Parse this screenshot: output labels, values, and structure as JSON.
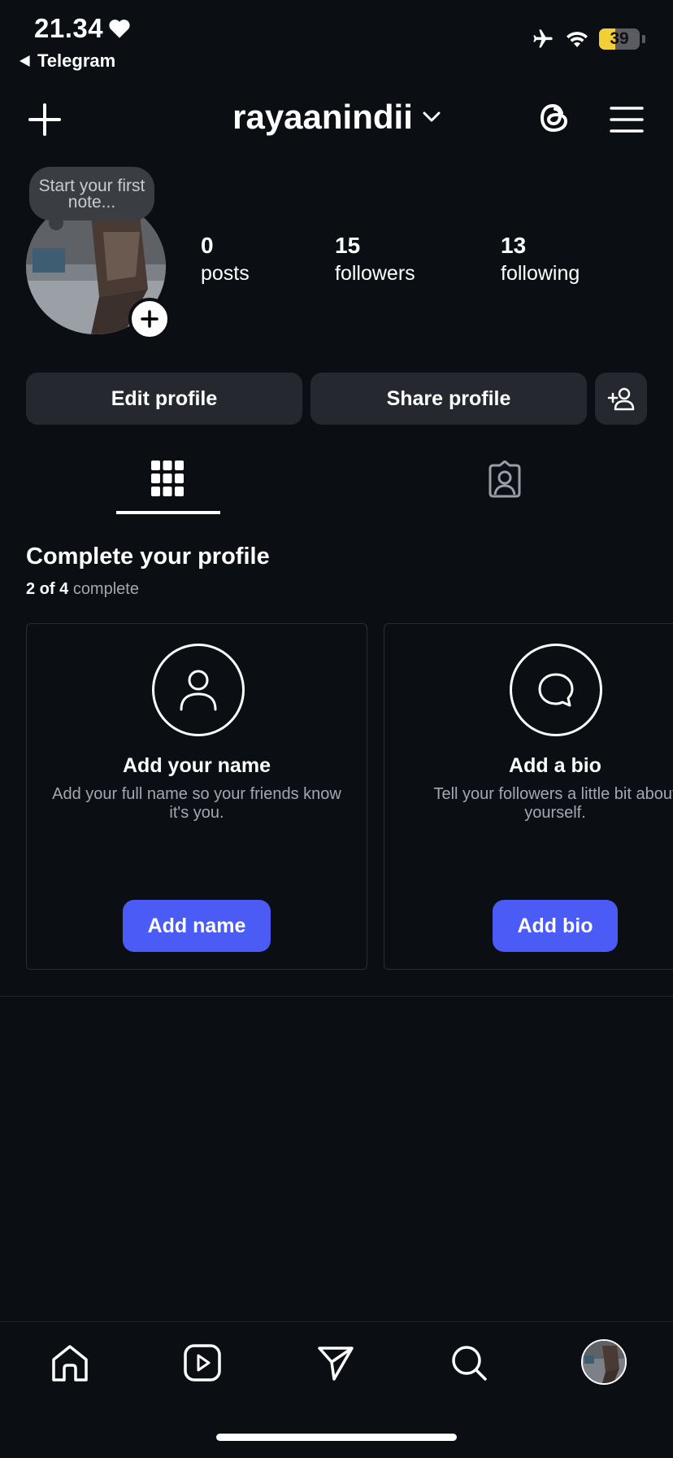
{
  "status_bar": {
    "time": "21.34",
    "back_app": "Telegram",
    "battery_level": "39",
    "battery_fraction": 0.39,
    "icons": [
      "heart-icon",
      "airplane-icon",
      "wifi-icon",
      "battery-icon"
    ]
  },
  "header": {
    "username": "rayaanindii",
    "icons": [
      "plus-icon",
      "chevron-down-icon",
      "threads-icon",
      "menu-icon"
    ]
  },
  "profile": {
    "note_placeholder": "Start your first note...",
    "stats": [
      {
        "value": "0",
        "label": "posts"
      },
      {
        "value": "15",
        "label": "followers"
      },
      {
        "value": "13",
        "label": "following"
      }
    ]
  },
  "actions": {
    "edit_profile": "Edit profile",
    "share_profile": "Share profile",
    "discover_icon": "add-person-icon"
  },
  "tabs": [
    {
      "name": "grid",
      "icon": "grid-icon",
      "active": true
    },
    {
      "name": "tagged",
      "icon": "tagged-person-icon",
      "active": false
    }
  ],
  "complete_profile": {
    "title": "Complete your profile",
    "progress_done": "2 of 4",
    "progress_suffix": "complete",
    "cards": [
      {
        "icon": "person-icon",
        "title": "Add your name",
        "description": "Add your full name so your friends know it's you.",
        "button": "Add name"
      },
      {
        "icon": "chat-bubble-icon",
        "title": "Add a bio",
        "description": "Tell your followers a little bit about yourself.",
        "button": "Add bio"
      }
    ]
  },
  "bottom_nav": {
    "items": [
      "home-icon",
      "reels-icon",
      "direct-icon",
      "search-icon",
      "profile-avatar"
    ]
  },
  "colors": {
    "background": "#0b0e13",
    "button": "#25292f",
    "accent": "#4a5cf5",
    "battery": "#f2cf36"
  }
}
